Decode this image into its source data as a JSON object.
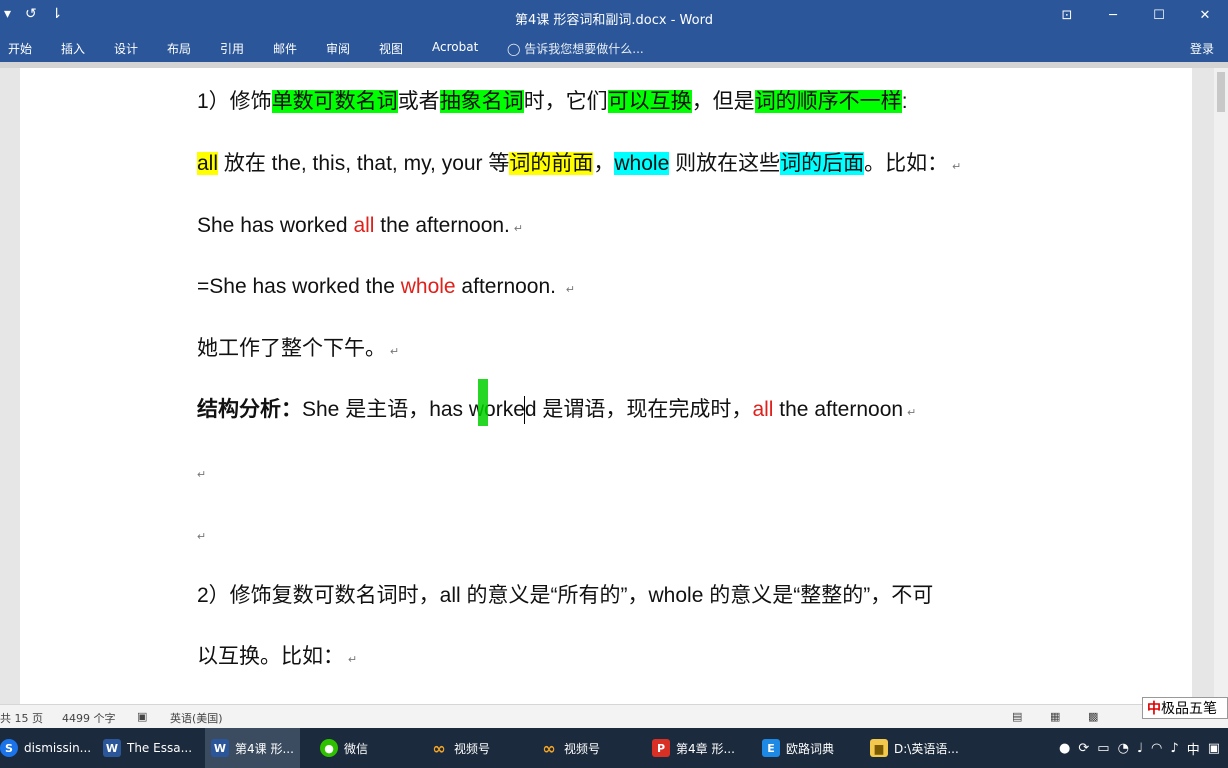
{
  "window": {
    "title": "第4课 形容词和副词.docx - Word",
    "qat": [
      "▾",
      "↺",
      "⇂"
    ],
    "controls": [
      "⊡",
      "─",
      "☐",
      "✕"
    ]
  },
  "ribbon": {
    "tabs": [
      "开始",
      "插入",
      "设计",
      "布局",
      "引用",
      "邮件",
      "审阅",
      "视图",
      "Acrobat"
    ],
    "tell_me": "告诉我您想要做什么...",
    "sign_in": "登录"
  },
  "document": {
    "p1": {
      "a": "1）修饰",
      "b": "单数可数名词",
      "c": "或者",
      "d": "抽象名词",
      "e": "时，它们",
      "f": "可以互换",
      "g": "，但是",
      "h": "词的顺序不一样",
      "i": ":"
    },
    "p2": {
      "a": "all",
      "b": " 放在 the, this, that, my, your 等",
      "c": "词的前面",
      "d": "，",
      "e": "whole",
      "f": " 则放在这些",
      "g": "词的后面",
      "h": "。比如："
    },
    "p3": {
      "a": "She has worked ",
      "b": "all",
      "c": " the afternoon."
    },
    "p4": {
      "a": "=She has worked the ",
      "b": "whole",
      "c": " afternoon. "
    },
    "p5": "她工作了整个下午。",
    "p6": {
      "a": "结构分析：",
      "b": "She 是主语，has worked 是谓语，现在完成时，",
      "c": "all",
      "d": " the afternoon"
    },
    "p9": "2）修饰复数可数名词时，all 的意义是“所有的”，whole 的意义是“整整的”，不可",
    "p10": "以互换。比如：",
    "para_mark": "↵"
  },
  "statusbar": {
    "pages": "共 15 页",
    "words": "4499 个字",
    "language": "英语(美国)"
  },
  "ime": {
    "mark": "中",
    "label": "极品五笔"
  },
  "taskbar": {
    "items": [
      {
        "label": "dismissin..."
      },
      {
        "label": "The Essa..."
      },
      {
        "label": "第4课 形..."
      },
      {
        "label": "微信"
      },
      {
        "label": "视频号"
      },
      {
        "label": "视频号"
      },
      {
        "label": "第4章 形..."
      },
      {
        "label": "欧路词典"
      },
      {
        "label": "D:\\英语语..."
      }
    ],
    "tray_lang": "中"
  },
  "colors": {
    "accent": "#2b579a",
    "green_highlight": "#00ff00",
    "yellow_highlight": "#ffff00",
    "cyan_highlight": "#00ffff",
    "red_text": "#e0201a"
  }
}
